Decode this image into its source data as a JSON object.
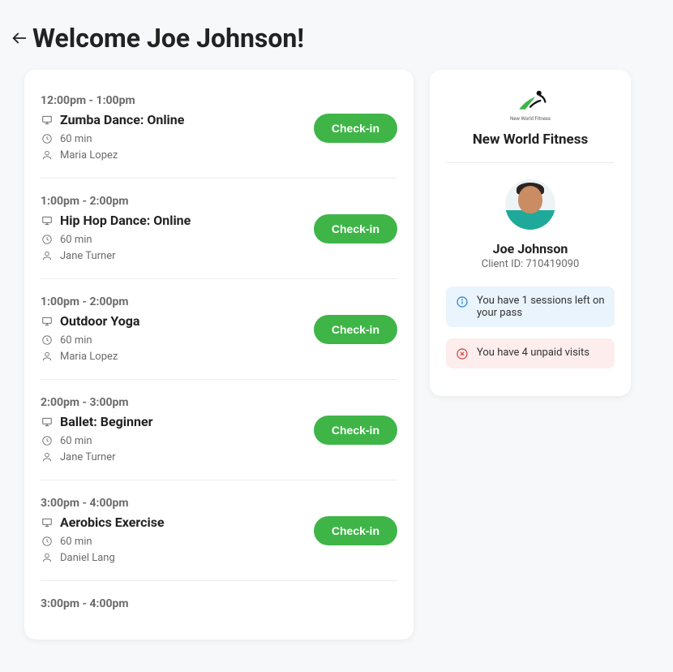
{
  "header": {
    "title": "Welcome Joe Johnson!"
  },
  "checkin_label": "Check-in",
  "classes": [
    {
      "time": "12:00pm - 1:00pm",
      "title": "Zumba Dance: Online",
      "duration": "60 min",
      "instructor": "Maria Lopez"
    },
    {
      "time": "1:00pm - 2:00pm",
      "title": "Hip Hop Dance: Online",
      "duration": "60 min",
      "instructor": "Jane Turner"
    },
    {
      "time": "1:00pm - 2:00pm",
      "title": "Outdoor Yoga",
      "duration": "60 min",
      "instructor": "Maria Lopez"
    },
    {
      "time": "2:00pm - 3:00pm",
      "title": "Ballet: Beginner",
      "duration": "60 min",
      "instructor": "Jane Turner"
    },
    {
      "time": "3:00pm - 4:00pm",
      "title": "Aerobics Exercise",
      "duration": "60 min",
      "instructor": "Daniel Lang"
    },
    {
      "time": "3:00pm - 4:00pm",
      "title": "",
      "duration": "",
      "instructor": ""
    }
  ],
  "profile": {
    "gym_name": "New World Fitness",
    "logo_label": "New World Fitness",
    "client_name": "Joe Johnson",
    "client_id": "Client ID: 710419090",
    "alerts": [
      {
        "type": "info",
        "text": "You have 1 sessions left on your pass"
      },
      {
        "type": "warn",
        "text": "You have 4 unpaid visits"
      }
    ]
  }
}
